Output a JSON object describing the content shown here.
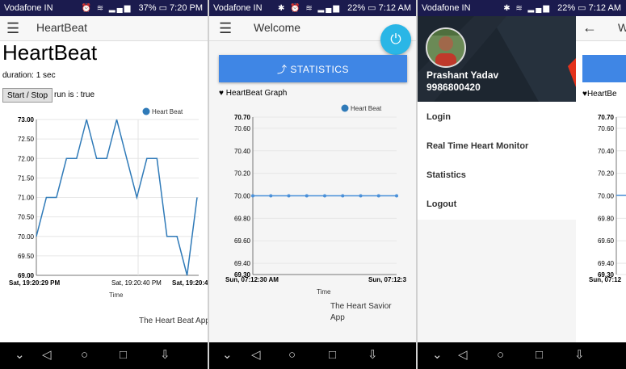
{
  "screens": {
    "s1": {
      "status": {
        "carrier": "Vodafone IN",
        "battery": "37%",
        "time": "7:20 PM"
      },
      "appbar_title": "HeartBeat",
      "heading": "HeartBeat",
      "duration": "duration: 1 sec",
      "start_stop_label": "Start / Stop",
      "run_status": "run is : true",
      "legend": "Heart Beat",
      "y_ticks": [
        "73.00",
        "72.50",
        "72.00",
        "71.50",
        "71.00",
        "70.50",
        "70.00",
        "69.50",
        "69.00"
      ],
      "x_ticks": [
        "Sat, 19:20:29 PM",
        "Sat, 19:20:40 PM",
        "Sat, 19:20:4"
      ],
      "xlabel": "Time",
      "footer": "The Heart Beat App"
    },
    "s2": {
      "status": {
        "carrier": "Vodafone IN",
        "battery": "22%",
        "time": "7:12 AM"
      },
      "appbar_title": "Welcome",
      "statistics_button": "STATISTICS",
      "graph_title": "HeartBeat Graph",
      "legend": "Heart Beat",
      "y_ticks": [
        "70.70",
        "70.60",
        "70.40",
        "70.20",
        "70.00",
        "69.80",
        "69.60",
        "69.40",
        "69.30"
      ],
      "x_ticks": [
        "Sun, 07:12:30 AM",
        "Sun, 07:12:3"
      ],
      "xlabel": "Time",
      "footer": "The Heart Savior App"
    },
    "s3": {
      "status": {
        "carrier": "Vodafone IN",
        "battery": "22%",
        "time": "7:12 AM"
      },
      "user_name": "Prashant Yadav",
      "user_phone": "9986800420",
      "menu_items": [
        "Login",
        "Real Time Heart Monitor",
        "Statistics",
        "Logout"
      ],
      "partial_title": "W",
      "graph_title": "HeartBe",
      "y_ticks": [
        "70.70",
        "70.60",
        "70.40",
        "70.20",
        "70.00",
        "69.80",
        "69.60",
        "69.40",
        "69.30"
      ],
      "x_tick": "Sun, 07:12"
    }
  },
  "chart_data": [
    {
      "type": "line",
      "series": [
        {
          "name": "Heart Beat",
          "values": [
            70,
            71,
            71,
            72,
            72,
            73,
            72,
            72,
            73,
            72,
            71,
            72,
            72,
            70,
            70,
            69,
            71
          ]
        }
      ],
      "ylim": [
        69,
        73
      ],
      "xlabel": "Time",
      "x_tick_labels": [
        "Sat, 19:20:29 PM",
        "Sat, 19:20:40 PM"
      ],
      "color": "#2f7ab8"
    },
    {
      "type": "line",
      "series": [
        {
          "name": "Heart Beat",
          "values": [
            70,
            70,
            70,
            70,
            70,
            70,
            70,
            70,
            70
          ]
        }
      ],
      "ylim": [
        69.3,
        70.7
      ],
      "xlabel": "Time",
      "x_tick_labels": [
        "Sun, 07:12:30 AM"
      ],
      "color": "#4a90d9"
    }
  ],
  "nav_icons": [
    "back-triangle",
    "home-circle",
    "recents-square",
    "notification-down-arrow",
    "collapse-chevron"
  ],
  "colors": {
    "status_bar": "#1b1b4e",
    "accent": "#3f86e5",
    "fab": "#2ab6e6",
    "line": "#2f7ab8"
  }
}
